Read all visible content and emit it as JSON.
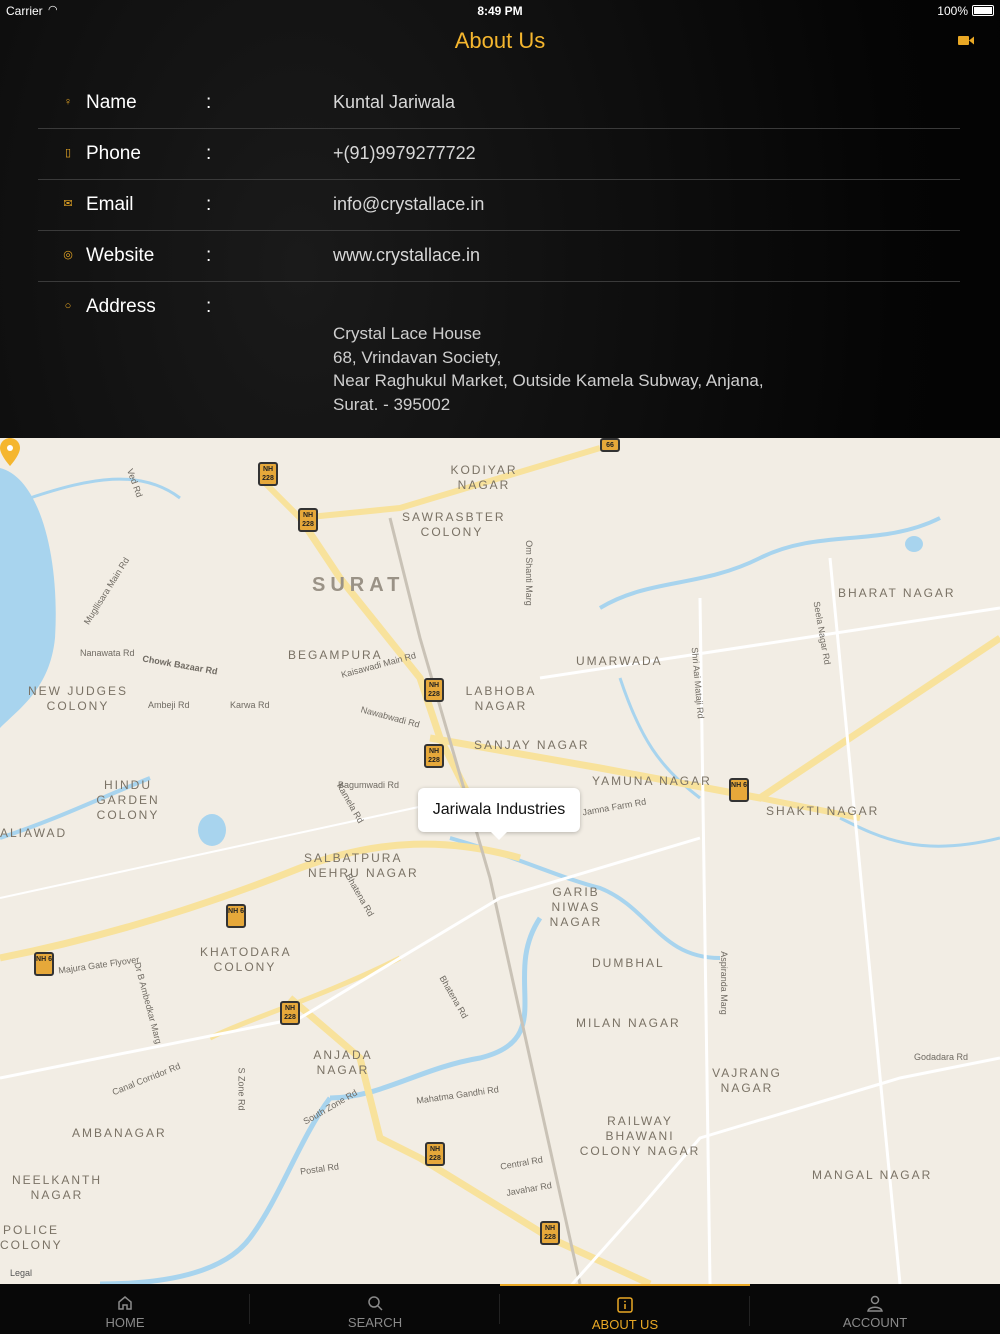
{
  "status_bar": {
    "carrier": "Carrier",
    "time": "8:49 PM",
    "battery": "100%"
  },
  "nav": {
    "title": "About Us",
    "action_icon": "video-camera-icon"
  },
  "contact": {
    "colon": ":",
    "rows": [
      {
        "label": "Name",
        "value": "Kuntal Jariwala",
        "icon": "person-icon"
      },
      {
        "label": "Phone",
        "value": "+(91)9979277722",
        "icon": "phone-icon"
      },
      {
        "label": "Email",
        "value": "info@crystallace.in",
        "icon": "envelope-icon"
      },
      {
        "label": "Website",
        "value": "www.crystallace.in",
        "icon": "globe-icon"
      },
      {
        "label": "Address",
        "icon": "location-pin-icon"
      }
    ],
    "address_lines": [
      "Crystal Lace House",
      "68, Vrindavan Society,",
      "Near Raghukul Market, Outside Kamela Subway, Anjana,",
      "Surat. - 395002"
    ]
  },
  "map": {
    "callout": "Jariwala Industries",
    "legal": "Legal",
    "city": "SURAT",
    "areas": [
      "KODIYAR NAGAR",
      "SAWRASBTER COLONY",
      "BEGAMPURA",
      "NEW JUDGES COLONY",
      "LABHOBA NAGAR",
      "UMARWADA",
      "BHARAT NAGAR",
      "SANJAY NAGAR",
      "YAMUNA NAGAR",
      "HINDU GARDEN COLONY",
      "SHAKTI NAGAR",
      "SALBATPURA",
      "NEHRU NAGAR",
      "GARIB NIWAS NAGAR",
      "KHATODARA COLONY",
      "DUMBHAL",
      "MILAN NAGAR",
      "ANJADA NAGAR",
      "VAJRANG NAGAR",
      "AMBANAGAR",
      "RAILWAY BHAWANI COLONY NAGAR",
      "NEELKANTH NAGAR",
      "MANGAL NAGAR",
      "POLICE COLONY",
      "ALIAWAD"
    ],
    "streets": [
      "Ved Rd",
      "Mugllisara Main Rd",
      "Nanawata Rd",
      "Chowk Bazaar Rd",
      "Ambeji Rd",
      "Karwa Rd",
      "Kaisawadi Main Rd",
      "Nawabwadi Rd",
      "Om Shanti Marg",
      "Shri Aai Mataji Rd",
      "Seela Nagar Rd",
      "Bagumwadi Rd",
      "Kamela Rd",
      "Bhatena Rd",
      "Majura Gate Flyover",
      "Dr B Ambedkar Marg",
      "Canal Corridor Rd",
      "S Zone Rd",
      "South Zone Rd",
      "Mahatma Gandhi Rd",
      "Postal Rd",
      "Central Rd",
      "Javahar Rd",
      "Godadara Rd",
      "Aspiranda Marg",
      "Bhatena Rd",
      "Jamna Farm Rd"
    ],
    "shields": [
      "NH 228",
      "NH 228",
      "NH 228",
      "NH 228",
      "NH 6",
      "NH 6",
      "NH 6",
      "NH 228",
      "NH 228",
      "NH 228",
      "66"
    ]
  },
  "tabs": [
    {
      "label": "HOME",
      "icon": "home-icon",
      "active": false
    },
    {
      "label": "SEARCH",
      "icon": "search-icon",
      "active": false
    },
    {
      "label": "ABOUT US",
      "icon": "info-icon",
      "active": true
    },
    {
      "label": "ACCOUNT",
      "icon": "person-icon",
      "active": false
    }
  ],
  "colors": {
    "accent": "#e9a825",
    "title": "#f5b62e",
    "map_bg": "#f2ede4",
    "water": "#a8d4ee",
    "road": "#f8e29c"
  }
}
